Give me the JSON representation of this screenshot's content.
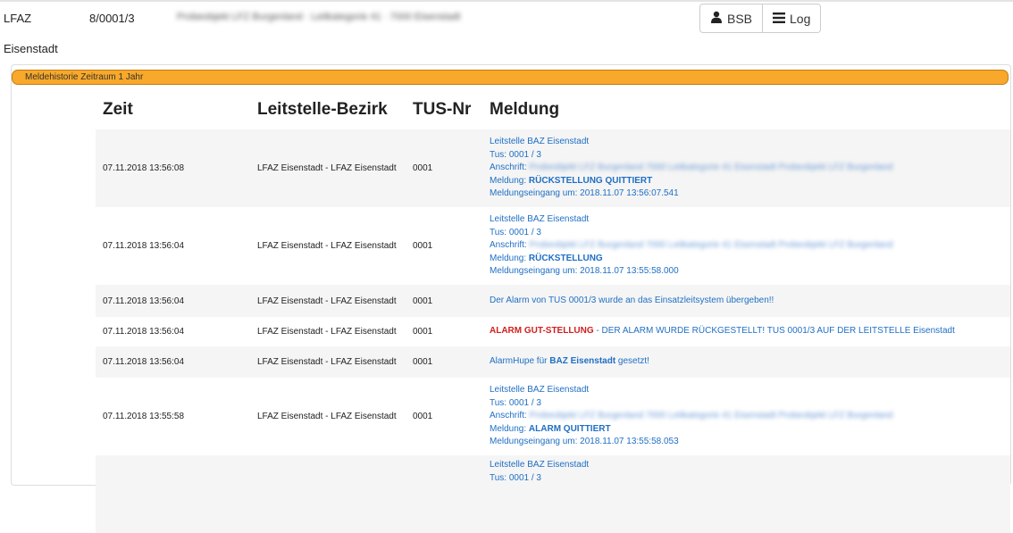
{
  "header": {
    "org": "LFAZ",
    "object_id": "8/0001/3",
    "object_desc": "Probeobjekt LFZ Burgenland · Leitkategorie 41 · 7000 Eisenstadt",
    "city": "Eisenstadt",
    "buttons": {
      "bsb": "BSB",
      "log": "Log"
    }
  },
  "panel": {
    "title": "Meldehistorie Zeitraum 1 Jahr"
  },
  "table": {
    "columns": [
      "Zeit",
      "Leitstelle-Bezirk",
      "TUS-Nr",
      "Meldung"
    ],
    "rows": [
      {
        "time": "07.11.2018 13:56:08",
        "district": "LFAZ Eisenstadt - LFAZ Eisenstadt",
        "tus": "0001",
        "msg": {
          "l1": "Leitstelle BAZ Eisenstadt",
          "l2": "Tus: 0001 / 3",
          "l3a": "Anschrift:",
          "l3b": "Probeobjekt LFZ Burgenland 7000 Leitkategorie 41 Eisenstadt Probeobjekt LFZ Burgenland",
          "l4a": "Meldung:",
          "l4b": "RÜCKSTELLUNG QUITTIERT",
          "l5": "Meldungseingang um: 2018.11.07 13:56:07.541"
        }
      },
      {
        "time": "07.11.2018 13:56:04",
        "district": "LFAZ Eisenstadt - LFAZ Eisenstadt",
        "tus": "0001",
        "msg": {
          "l1": "Leitstelle BAZ Eisenstadt",
          "l2": "Tus: 0001 / 3",
          "l3a": "Anschrift:",
          "l3b": "Probeobjekt LFZ Burgenland 7000 Leitkategorie 41 Eisenstadt Probeobjekt LFZ Burgenland",
          "l4a": "Meldung:",
          "l4b": "RÜCKSTELLUNG",
          "l5": "Meldungseingang um: 2018.11.07 13:55:58.000"
        }
      },
      {
        "time": "07.11.2018 13:56:04",
        "district": "LFAZ Eisenstadt - LFAZ Eisenstadt",
        "tus": "0001",
        "text": "Der Alarm von TUS 0001/3 wurde an das Einsatzleitsystem übergeben!!"
      },
      {
        "time": "07.11.2018 13:56:04",
        "district": "LFAZ Eisenstadt - LFAZ Eisenstadt",
        "tus": "0001",
        "alarm_label": "ALARM GUT-STELLUNG",
        "alarm_rest": " - DER ALARM WURDE RÜCKGESTELLT! TUS 0001/3 AUF DER LEITSTELLE Eisenstadt"
      },
      {
        "time": "07.11.2018 13:56:04",
        "district": "LFAZ Eisenstadt - LFAZ Eisenstadt",
        "tus": "0001",
        "hupe_a": "AlarmHupe für ",
        "hupe_b": "BAZ Eisenstadt",
        "hupe_c": " gesetzt!"
      },
      {
        "time": "07.11.2018 13:55:58",
        "district": "LFAZ Eisenstadt - LFAZ Eisenstadt",
        "tus": "0001",
        "msg": {
          "l1": "Leitstelle BAZ Eisenstadt",
          "l2": "Tus: 0001 / 3",
          "l3a": "Anschrift:",
          "l3b": "Probeobjekt LFZ Burgenland 7000 Leitkategorie 41 Eisenstadt Probeobjekt LFZ Burgenland",
          "l4a": "Meldung:",
          "l4b": "ALARM QUITTIERT",
          "l5": "Meldungseingang um: 2018.11.07 13:55:58.053"
        }
      },
      {
        "time": "",
        "district": "",
        "tus": "",
        "msg_partial": {
          "l1": "Leitstelle BAZ Eisenstadt",
          "l2": "Tus: 0001 / 3"
        }
      }
    ]
  }
}
